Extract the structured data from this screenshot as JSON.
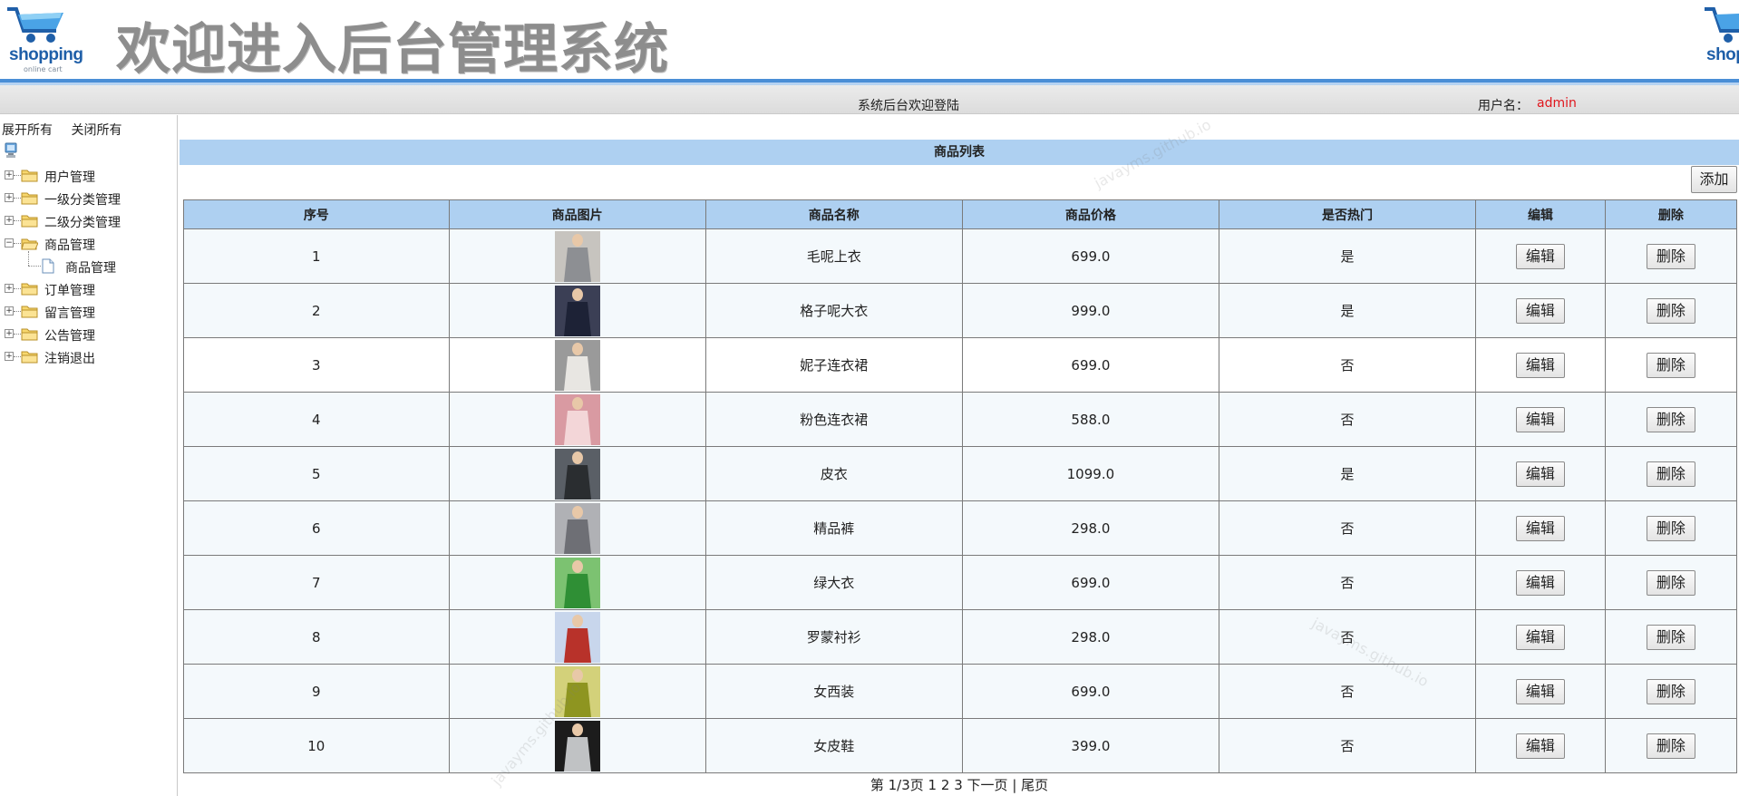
{
  "header": {
    "logo_text": "shopping",
    "logo_subtext": "online cart",
    "title": "欢迎进入后台管理系统"
  },
  "statusbar": {
    "welcome": "系统后台欢迎登陆",
    "user_label": "用户名：",
    "user_name": "admin"
  },
  "sidebar": {
    "expand_all": "展开所有",
    "collapse_all": "关闭所有",
    "items": [
      {
        "label": "用户管理",
        "expanded": false
      },
      {
        "label": "一级分类管理",
        "expanded": false
      },
      {
        "label": "二级分类管理",
        "expanded": false
      },
      {
        "label": "商品管理",
        "expanded": true,
        "children": [
          "商品管理"
        ]
      },
      {
        "label": "订单管理",
        "expanded": false
      },
      {
        "label": "留言管理",
        "expanded": false
      },
      {
        "label": "公告管理",
        "expanded": false
      },
      {
        "label": "注销退出",
        "expanded": false
      }
    ]
  },
  "main": {
    "list_title": "商品列表",
    "add_label": "添加",
    "columns": [
      "序号",
      "商品图片",
      "商品名称",
      "商品价格",
      "是否热门",
      "编辑",
      "删除"
    ],
    "rows": [
      {
        "no": "1",
        "name": "毛呢上衣",
        "price": "699.0",
        "hot": "是",
        "edit": "编辑",
        "delete": "删除"
      },
      {
        "no": "2",
        "name": "格子呢大衣",
        "price": "999.0",
        "hot": "是",
        "edit": "编辑",
        "delete": "删除"
      },
      {
        "no": "3",
        "name": "妮子连衣裙",
        "price": "699.0",
        "hot": "否",
        "edit": "编辑",
        "delete": "删除"
      },
      {
        "no": "4",
        "name": "粉色连衣裙",
        "price": "588.0",
        "hot": "否",
        "edit": "编辑",
        "delete": "删除"
      },
      {
        "no": "5",
        "name": "皮衣",
        "price": "1099.0",
        "hot": "是",
        "edit": "编辑",
        "delete": "删除"
      },
      {
        "no": "6",
        "name": "精品裤",
        "price": "298.0",
        "hot": "否",
        "edit": "编辑",
        "delete": "删除"
      },
      {
        "no": "7",
        "name": "绿大衣",
        "price": "699.0",
        "hot": "否",
        "edit": "编辑",
        "delete": "删除"
      },
      {
        "no": "8",
        "name": "罗蒙衬衫",
        "price": "298.0",
        "hot": "否",
        "edit": "编辑",
        "delete": "删除"
      },
      {
        "no": "9",
        "name": "女西装",
        "price": "699.0",
        "hot": "否",
        "edit": "编辑",
        "delete": "删除"
      },
      {
        "no": "10",
        "name": "女皮鞋",
        "price": "399.0",
        "hot": "否",
        "edit": "编辑",
        "delete": "删除"
      }
    ],
    "thumb_colors": [
      [
        "#8d8f93",
        "#c7c4bf"
      ],
      [
        "#1d2236",
        "#3b3f55"
      ],
      [
        "#e8e6e2",
        "#9a9a9a"
      ],
      [
        "#f3d6d8",
        "#d99aa2"
      ],
      [
        "#2a2d30",
        "#5a5f66"
      ],
      [
        "#6e6f75",
        "#b0b1b5"
      ],
      [
        "#2f8f35",
        "#7cc271"
      ],
      [
        "#b8322a",
        "#c8d6ec"
      ],
      [
        "#8e9520",
        "#d3d17a"
      ],
      [
        "#c0c2c4",
        "#1c1c1c"
      ]
    ],
    "pager": {
      "prefix": "第",
      "current": "1/3",
      "suffix": "页",
      "pages": [
        "1",
        "2",
        "3"
      ],
      "next": "下一页",
      "sep": "|",
      "last": "尾页"
    }
  },
  "watermark": "javayms.github.io",
  "colors": {
    "accent": "#4a8ed6",
    "table_header": "#aed0f1",
    "username": "#e0161d"
  }
}
